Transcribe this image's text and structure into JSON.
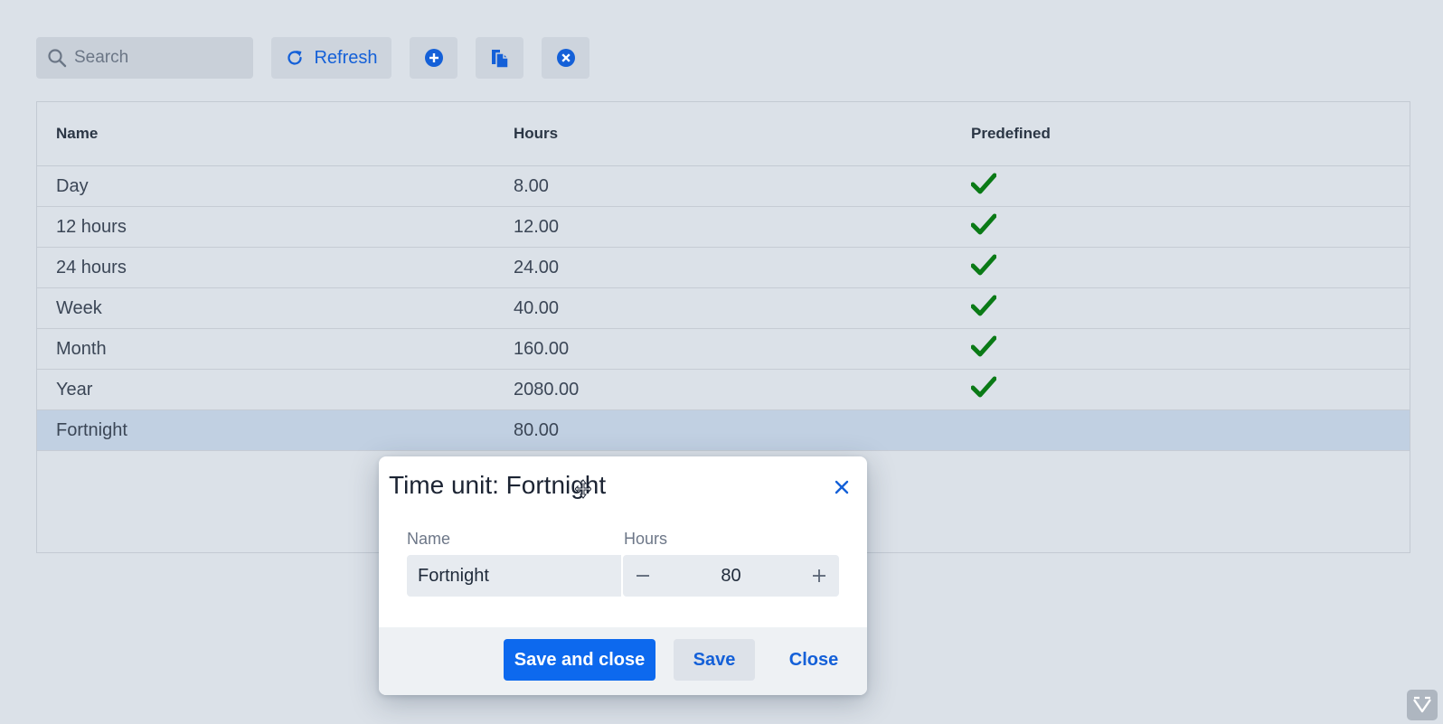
{
  "toolbar": {
    "search_placeholder": "Search",
    "refresh_label": "Refresh",
    "add_icon": "plus-circle-icon",
    "copy_icon": "copy-icon",
    "remove_icon": "x-circle-icon"
  },
  "table": {
    "columns": [
      "Name",
      "Hours",
      "Predefined"
    ],
    "rows": [
      {
        "name": "Day",
        "hours": "8.00",
        "predefined": true
      },
      {
        "name": "12 hours",
        "hours": "12.00",
        "predefined": true
      },
      {
        "name": "24 hours",
        "hours": "24.00",
        "predefined": true
      },
      {
        "name": "Week",
        "hours": "40.00",
        "predefined": true
      },
      {
        "name": "Month",
        "hours": "160.00",
        "predefined": true
      },
      {
        "name": "Year",
        "hours": "2080.00",
        "predefined": true
      },
      {
        "name": "Fortnight",
        "hours": "80.00",
        "predefined": false
      }
    ],
    "selected_row": "Fortnight"
  },
  "dialog": {
    "title": "Time unit: Fortnight",
    "name_label": "Name",
    "name_value": "Fortnight",
    "hours_label": "Hours",
    "hours_value": "80",
    "save_close_label": "Save and close",
    "save_label": "Save",
    "close_label": "Close"
  },
  "colors": {
    "accent": "#0d69ee",
    "check": "#0a7a16",
    "background": "#dbe1e8"
  }
}
